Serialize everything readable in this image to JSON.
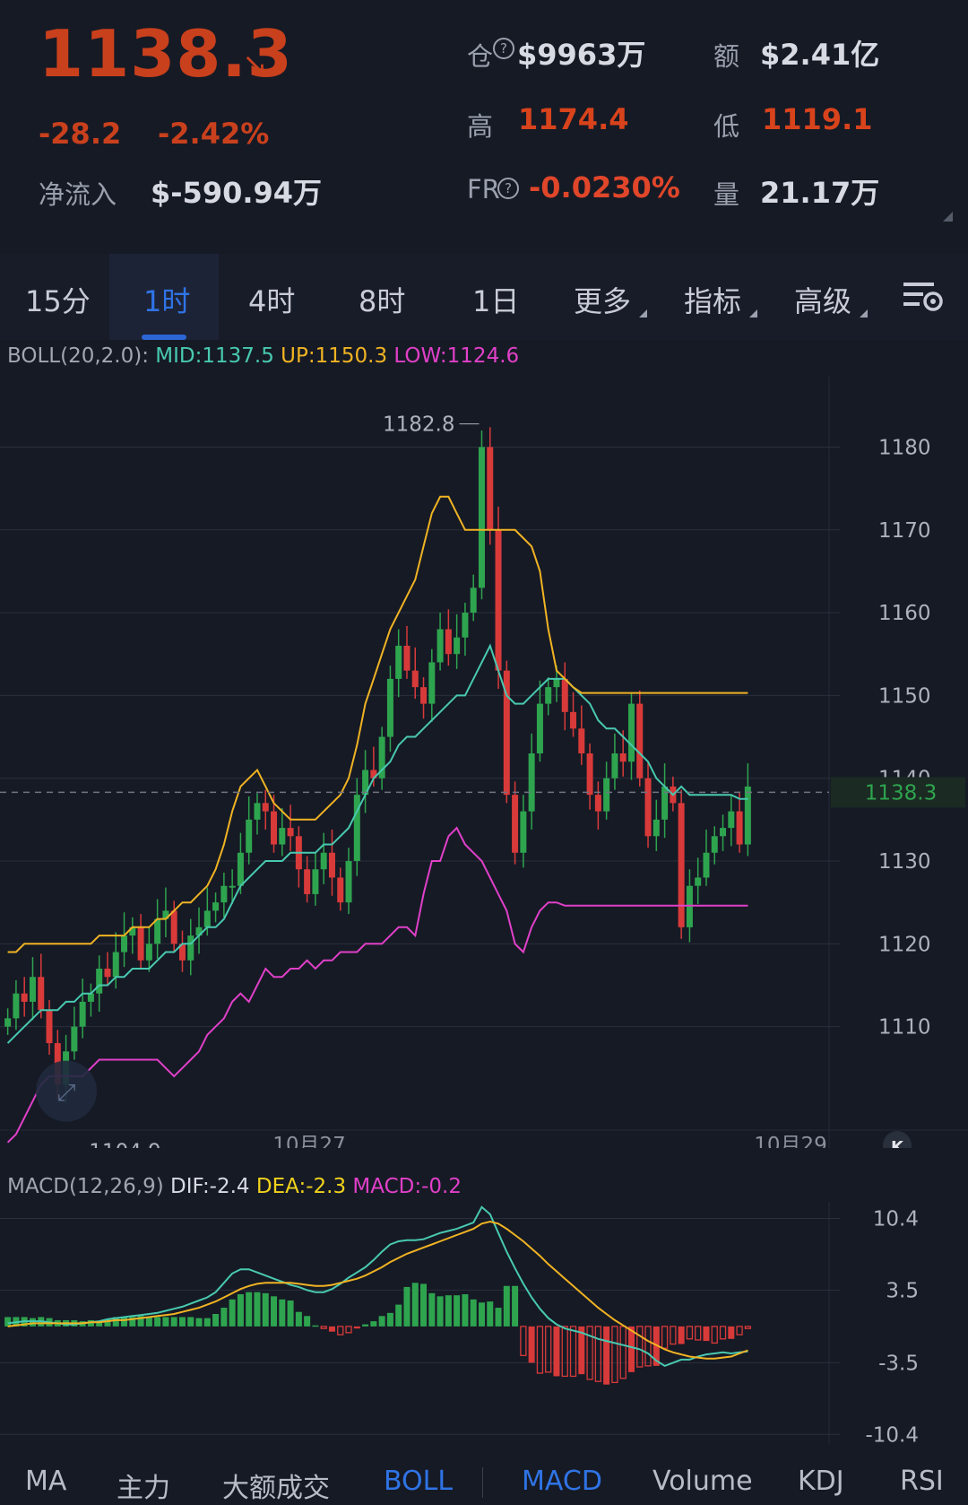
{
  "header": {
    "price": "1138.3",
    "change": "-28.2",
    "change_pct": "-2.42%",
    "net_inflow_label": "净流入",
    "net_inflow": "$-590.94万",
    "oi_label": "仓",
    "oi_value": "$9963万",
    "amount_label": "额",
    "amount_value": "$2.41亿",
    "high_label": "高",
    "high_value": "1174.4",
    "low_label": "低",
    "low_value": "1119.1",
    "fr_label": "FR",
    "fr_value": "-0.0230%",
    "vol_label": "量",
    "vol_value": "21.17万"
  },
  "tabs": [
    "15分",
    "1时",
    "4时",
    "8时",
    "1日",
    "更多",
    "指标",
    "高级"
  ],
  "active_tab": "1时",
  "boll": {
    "name": "BOLL(20,2.0):",
    "mid": "MID:1137.5",
    "up": "UP:1150.3",
    "low": "LOW:1124.6",
    "mid_color": "#48c9b0",
    "up_color": "#f0b323",
    "low_color": "#e040c8"
  },
  "macd_legend": {
    "name": "MACD(12,26,9)",
    "dif": "DIF:-2.4",
    "dea": "DEA:-2.3",
    "macd": "MACD:-0.2"
  },
  "bottom_tabs": [
    "MA",
    "主力",
    "大额成交",
    "BOLL",
    "MACD",
    "Volume",
    "KDJ",
    "RSI"
  ],
  "active_bottom_tabs": [
    "BOLL",
    "MACD"
  ],
  "colors": {
    "up": "#2ea44f",
    "down": "#d83a3a",
    "accent": "#2d66d6",
    "header_red": "#c9401d"
  },
  "chart_data": [
    {
      "type": "candlestick",
      "title": "",
      "y_ticks": [
        1180,
        1170,
        1160,
        1150,
        1140,
        1130,
        1120,
        1110
      ],
      "y_tick_labels": [
        "1180",
        "1170",
        "1160",
        "1150",
        "1140",
        "1130",
        "1120",
        "1110"
      ],
      "ylim": [
        1097.5,
        1188.5
      ],
      "x_tick_labels": [
        "10月27",
        "10月29"
      ],
      "last_price_label": "1138.3",
      "max_label": "1182.8",
      "min_label": "1104.9",
      "last_price": 1138.3,
      "candles_close": [
        1111,
        1114,
        1113,
        1116,
        1112,
        1108,
        1103,
        1107,
        1110,
        1113,
        1114,
        1117,
        1116,
        1119,
        1121,
        1122,
        1118,
        1120,
        1123,
        1124,
        1120,
        1118,
        1121,
        1122,
        1124,
        1125,
        1127,
        1127,
        1131,
        1135,
        1137,
        1136,
        1132,
        1134,
        1133,
        1129,
        1126,
        1129,
        1131,
        1128,
        1125,
        1130,
        1138,
        1141,
        1140,
        1145,
        1152,
        1156,
        1153,
        1151,
        1149,
        1154,
        1158,
        1155,
        1157,
        1160,
        1163,
        1180,
        1170,
        1153,
        1138,
        1131,
        1136,
        1143,
        1149,
        1151,
        1152,
        1148,
        1146,
        1143,
        1138,
        1136,
        1140,
        1143,
        1142,
        1149,
        1140,
        1133,
        1135,
        1139,
        1137,
        1122,
        1127,
        1128,
        1131,
        1133,
        1134,
        1136,
        1132,
        1139
      ],
      "series": [
        {
          "name": "MID",
          "values": [
            1108,
            1109,
            1110,
            1111,
            1112,
            1112,
            1112,
            1113,
            1113,
            1114,
            1114,
            1115,
            1115,
            1116,
            1116,
            1117,
            1117,
            1117,
            1118,
            1119,
            1119,
            1120,
            1120,
            1121,
            1122,
            1122,
            1123,
            1125,
            1127,
            1128,
            1129,
            1130,
            1130,
            1130,
            1131,
            1131,
            1131,
            1131,
            1132,
            1132,
            1133,
            1134,
            1136,
            1138,
            1140,
            1141,
            1142,
            1144,
            1145,
            1145,
            1146,
            1147,
            1148,
            1149,
            1150,
            1150,
            1152,
            1154,
            1156,
            1153,
            1150,
            1149,
            1149,
            1150,
            1151,
            1152,
            1152,
            1152,
            1151,
            1150,
            1149,
            1147,
            1146,
            1146,
            1145,
            1144,
            1143,
            1142,
            1140,
            1139,
            1138,
            1139,
            1138,
            1138,
            1138,
            1138,
            1138,
            1138,
            1137.5,
            1137.5
          ]
        },
        {
          "name": "UP",
          "values": [
            1119,
            1119,
            1120,
            1120,
            1120,
            1120,
            1120,
            1120,
            1120,
            1120,
            1120,
            1121,
            1121,
            1121,
            1121,
            1122,
            1122,
            1122,
            1123,
            1123,
            1124,
            1125,
            1125,
            1126,
            1127,
            1129,
            1132,
            1136,
            1139,
            1140,
            1141,
            1139,
            1137,
            1136,
            1135,
            1135,
            1135,
            1135,
            1136,
            1137,
            1138,
            1140,
            1144,
            1149,
            1152,
            1155,
            1158,
            1160,
            1162,
            1164,
            1168,
            1172,
            1174,
            1174,
            1172,
            1170,
            1170,
            1170,
            1170,
            1170,
            1170,
            1170,
            1169,
            1168,
            1165,
            1158,
            1153,
            1152,
            1151,
            1150.3,
            1150.3,
            1150.3,
            1150.3,
            1150.3,
            1150.3,
            1150.3,
            1150.3,
            1150.3,
            1150.3,
            1150.3,
            1150.3,
            1150.3,
            1150.3,
            1150.3,
            1150.3,
            1150.3,
            1150.3,
            1150.3,
            1150.3,
            1150.3
          ]
        },
        {
          "name": "LOW",
          "values": [
            1096,
            1097,
            1099,
            1101,
            1103,
            1104,
            1104,
            1104,
            1104,
            1104,
            1105,
            1106,
            1106,
            1106,
            1106,
            1106,
            1106,
            1106,
            1106,
            1105,
            1104,
            1105,
            1106,
            1107,
            1109,
            1110,
            1111,
            1113,
            1114,
            1113,
            1115,
            1117,
            1116,
            1116,
            1117,
            1117,
            1118,
            1117,
            1118,
            1118,
            1119,
            1119,
            1119,
            1120,
            1120,
            1120,
            1121,
            1122,
            1122,
            1121,
            1126,
            1130,
            1130,
            1133,
            1134,
            1132,
            1131,
            1130,
            1128,
            1126,
            1124,
            1120,
            1119,
            1122,
            1124,
            1125,
            1125,
            1124.6,
            1124.6,
            1124.6,
            1124.6,
            1124.6,
            1124.6,
            1124.6,
            1124.6,
            1124.6,
            1124.6,
            1124.6,
            1124.6,
            1124.6,
            1124.6,
            1124.6,
            1124.6,
            1124.6,
            1124.6,
            1124.6,
            1124.6,
            1124.6,
            1124.6,
            1124.6
          ]
        }
      ]
    },
    {
      "type": "bar",
      "title": "",
      "y_ticks": [
        10.4,
        3.5,
        -3.5,
        -10.4
      ],
      "y_tick_labels": [
        "10.4",
        "3.5",
        "-3.5",
        "-10.4"
      ],
      "ylim": [
        -11.5,
        12.0
      ],
      "histogram": [
        0.9,
        0.9,
        0.9,
        0.8,
        0.9,
        0.8,
        0.6,
        0.6,
        0.6,
        0.5,
        0.6,
        0.5,
        0.7,
        0.9,
        0.9,
        0.9,
        1.0,
        0.9,
        0.9,
        0.9,
        0.9,
        0.9,
        0.9,
        0.8,
        0.8,
        1.2,
        1.8,
        2.6,
        3.1,
        3.3,
        3.3,
        3.2,
        2.9,
        2.6,
        2.5,
        1.4,
        1.0,
        0.1,
        -0.2,
        -0.5,
        -0.8,
        -0.6,
        -0.2,
        0.2,
        0.5,
        1.0,
        1.3,
        2.1,
        3.8,
        4.2,
        4.1,
        3.2,
        2.9,
        3.0,
        3.0,
        3.1,
        2.6,
        2.3,
        2.4,
        1.8,
        3.9,
        3.9,
        -2.8,
        -3.5,
        -4.5,
        -4.4,
        -4.8,
        -4.8,
        -4.8,
        -4.6,
        -5.1,
        -5.3,
        -5.6,
        -5.4,
        -5.0,
        -4.4,
        -3.9,
        -3.8,
        -3.8,
        -2.1,
        -1.7,
        -1.7,
        -1.2,
        -1.3,
        -1.4,
        -1.6,
        -1.2,
        -1.2,
        -0.8,
        -0.2
      ],
      "series": [
        {
          "name": "DIF",
          "values": [
            0.3,
            0.4,
            0.5,
            0.5,
            0.5,
            0.4,
            0.3,
            0.2,
            0.2,
            0.3,
            0.4,
            0.5,
            0.7,
            0.8,
            0.9,
            1.0,
            1.1,
            1.2,
            1.3,
            1.5,
            1.7,
            1.9,
            2.2,
            2.5,
            2.8,
            3.3,
            4.2,
            5.1,
            5.5,
            5.5,
            5.2,
            4.9,
            4.6,
            4.3,
            4.0,
            3.8,
            3.5,
            3.3,
            3.3,
            3.6,
            4.1,
            4.7,
            5.2,
            5.7,
            6.4,
            7.2,
            7.9,
            8.2,
            8.3,
            8.3,
            8.4,
            8.7,
            9.0,
            9.2,
            9.4,
            9.7,
            10.0,
            11.5,
            10.8,
            9.0,
            7.2,
            5.6,
            4.1,
            2.8,
            1.7,
            0.8,
            0.2,
            -0.2,
            -0.4,
            -0.6,
            -0.9,
            -1.2,
            -1.4,
            -1.6,
            -1.8,
            -2.0,
            -2.2,
            -2.6,
            -3.3,
            -3.8,
            -3.5,
            -3.2,
            -3.2,
            -2.9,
            -2.7,
            -2.6,
            -2.5,
            -2.6,
            -2.5,
            -2.4
          ]
        },
        {
          "name": "DEA",
          "values": [
            0.0,
            0.1,
            0.2,
            0.3,
            0.3,
            0.3,
            0.3,
            0.3,
            0.3,
            0.3,
            0.4,
            0.4,
            0.5,
            0.6,
            0.6,
            0.7,
            0.8,
            0.9,
            1.0,
            1.1,
            1.2,
            1.4,
            1.6,
            1.8,
            2.1,
            2.4,
            2.8,
            3.2,
            3.6,
            3.9,
            4.1,
            4.2,
            4.2,
            4.2,
            4.2,
            4.1,
            4.0,
            3.9,
            3.9,
            4.0,
            4.2,
            4.4,
            4.6,
            4.9,
            5.3,
            5.7,
            6.2,
            6.6,
            7.0,
            7.3,
            7.6,
            7.9,
            8.2,
            8.5,
            8.8,
            9.1,
            9.4,
            9.9,
            10.1,
            9.9,
            9.4,
            8.8,
            8.2,
            7.5,
            6.8,
            6.0,
            5.3,
            4.6,
            3.9,
            3.2,
            2.5,
            1.8,
            1.2,
            0.6,
            0.1,
            -0.4,
            -0.9,
            -1.4,
            -1.8,
            -2.2,
            -2.5,
            -2.7,
            -2.9,
            -3.0,
            -3.1,
            -3.1,
            -3.0,
            -2.9,
            -2.6,
            -2.3
          ]
        }
      ]
    }
  ]
}
